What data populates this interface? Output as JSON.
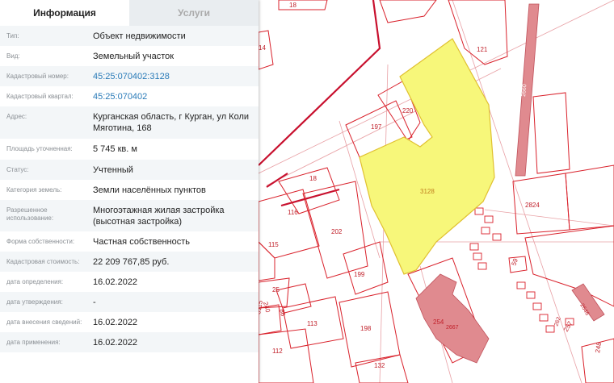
{
  "tabs": {
    "info": "Информация",
    "services": "Услуги"
  },
  "rows": [
    {
      "label": "Тип:",
      "value": "Объект недвижимости"
    },
    {
      "label": "Вид:",
      "value": "Земельный участок"
    },
    {
      "label": "Кадастровый номер:",
      "value": "45:25:070402:3128"
    },
    {
      "label": "Кадастровый квартал:",
      "value": "45:25:070402"
    },
    {
      "label": "Адрес:",
      "value": "Курганская область, г Курган, ул Коли Мяготина, 168"
    },
    {
      "label": "Площадь уточненная:",
      "value": "5 745 кв. м"
    },
    {
      "label": "Статус:",
      "value": "Учтенный"
    },
    {
      "label": "Категория земель:",
      "value": "Земли населённых пунктов"
    },
    {
      "label": "Разрешенное использование:",
      "value": "Многоэтажная жилая застройка (высотная застройка)"
    },
    {
      "label": "Форма собственности:",
      "value": "Частная собственность"
    },
    {
      "label": "Кадастровая стоимость:",
      "value": "22 209 767,85 руб."
    },
    {
      "label": "дата определения:",
      "value": "16.02.2022"
    },
    {
      "label": "дата утверждения:",
      "value": "-"
    },
    {
      "label": "дата внесения сведений:",
      "value": "16.02.2022"
    },
    {
      "label": "дата применения:",
      "value": "16.02.2022"
    }
  ],
  "map": {
    "labels": {
      "p18a": "18",
      "p14": "14",
      "p121": "121",
      "p220": "220",
      "p197": "197",
      "p3128": "3128",
      "p18b": "18",
      "p116": "116",
      "p202": "202",
      "p115": "115",
      "p199": "199",
      "p25": "25",
      "p240": "240",
      "p86": "86",
      "p3115": "3115",
      "p113": "113",
      "p198": "198",
      "p112": "112",
      "p132": "132",
      "p254": "254",
      "p2667": "2667",
      "p2824": "2824",
      "p59": "59",
      "p2646": "2646",
      "p257": "257",
      "p248": "248",
      "p2660": "2660",
      "p262": "262"
    },
    "colors": {
      "selected_fill": "#f7f77a",
      "selected_stroke": "#e0c030",
      "parcel": "#d9212b",
      "building": "#e08a8f"
    }
  }
}
